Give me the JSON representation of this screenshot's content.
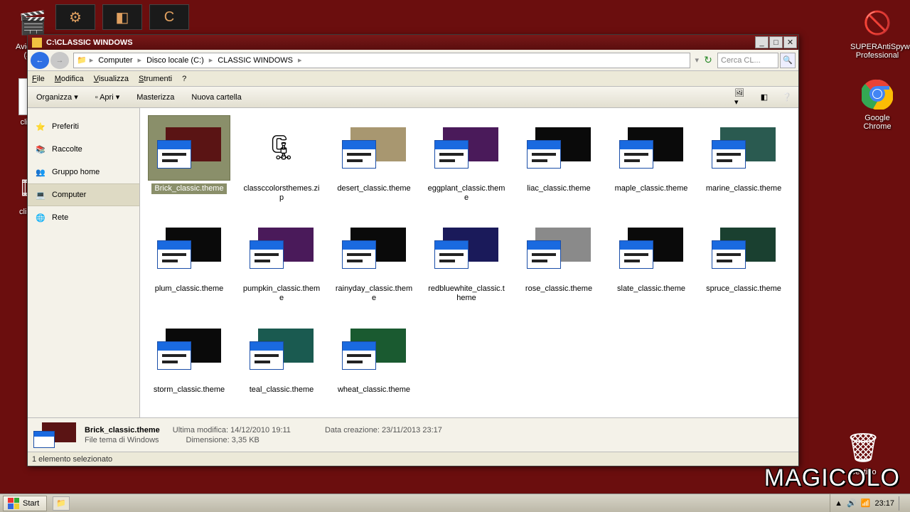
{
  "desktop": {
    "icons": {
      "avidemux": "Avidemux (32...",
      "superanti": "SUPERAntiSpyware Professional",
      "chrome": "Google Chrome",
      "trash": "Cestino",
      "clip009": "clip009",
      "clip00x": "clip00..."
    },
    "watermark": "MAGICOLO"
  },
  "window": {
    "title": "C:\\CLASSIC WINDOWS",
    "breadcrumb": [
      "Computer",
      "Disco locale (C:)",
      "CLASSIC WINDOWS"
    ],
    "search_placeholder": "Cerca CL...",
    "menu": [
      "File",
      "Modifica",
      "Visualizza",
      "Strumenti",
      "?"
    ],
    "toolbar": {
      "organize": "Organizza",
      "open": "Apri",
      "burn": "Masterizza",
      "newfolder": "Nuova cartella"
    },
    "sidebar": [
      {
        "icon": "⭐",
        "label": "Preferiti"
      },
      {
        "icon": "📚",
        "label": "Raccolte"
      },
      {
        "icon": "👥",
        "label": "Gruppo home"
      },
      {
        "icon": "💻",
        "label": "Computer",
        "selected": true
      },
      {
        "icon": "🌐",
        "label": "Rete"
      }
    ],
    "items": [
      {
        "name": "Brick_classic.theme",
        "type": "theme",
        "color": "#5a1414",
        "selected": true
      },
      {
        "name": "classccolorsthemes.zip",
        "type": "zip"
      },
      {
        "name": "desert_classic.theme",
        "type": "theme",
        "color": "#a89770"
      },
      {
        "name": "eggplant_classic.theme",
        "type": "theme",
        "color": "#4a1a5a"
      },
      {
        "name": "liac_classic.theme",
        "type": "theme",
        "color": "#0a0a0a"
      },
      {
        "name": "maple_classic.theme",
        "type": "theme",
        "color": "#0a0a0a"
      },
      {
        "name": "marine_classic.theme",
        "type": "theme",
        "color": "#2a5a50"
      },
      {
        "name": "plum_classic.theme",
        "type": "theme",
        "color": "#0a0a0a"
      },
      {
        "name": "pumpkin_classic.theme",
        "type": "theme",
        "color": "#4a1a5a"
      },
      {
        "name": "rainyday_classic.theme",
        "type": "theme",
        "color": "#0a0a0a"
      },
      {
        "name": "redbluewhite_classic.theme",
        "type": "theme",
        "color": "#1a1a5a"
      },
      {
        "name": "rose_classic.theme",
        "type": "theme",
        "color": "#8a8a8a"
      },
      {
        "name": "slate_classic.theme",
        "type": "theme",
        "color": "#0a0a0a"
      },
      {
        "name": "spruce_classic.theme",
        "type": "theme",
        "color": "#1a4030"
      },
      {
        "name": "storm_classic.theme",
        "type": "theme",
        "color": "#0a0a0a"
      },
      {
        "name": "teal_classic.theme",
        "type": "theme",
        "color": "#1a5a50"
      },
      {
        "name": "wheat_classic.theme",
        "type": "theme",
        "color": "#1a5a30"
      }
    ],
    "details": {
      "filename": "Brick_classic.theme",
      "filetype": "File tema di Windows",
      "modified_label": "Ultima modifica:",
      "modified": "14/12/2010 19:11",
      "size_label": "Dimensione:",
      "size": "3,35 KB",
      "created_label": "Data creazione:",
      "created": "23/11/2013 23:17"
    },
    "status": "1 elemento selezionato"
  },
  "taskbar": {
    "start": "Start",
    "clock": "23:17"
  }
}
